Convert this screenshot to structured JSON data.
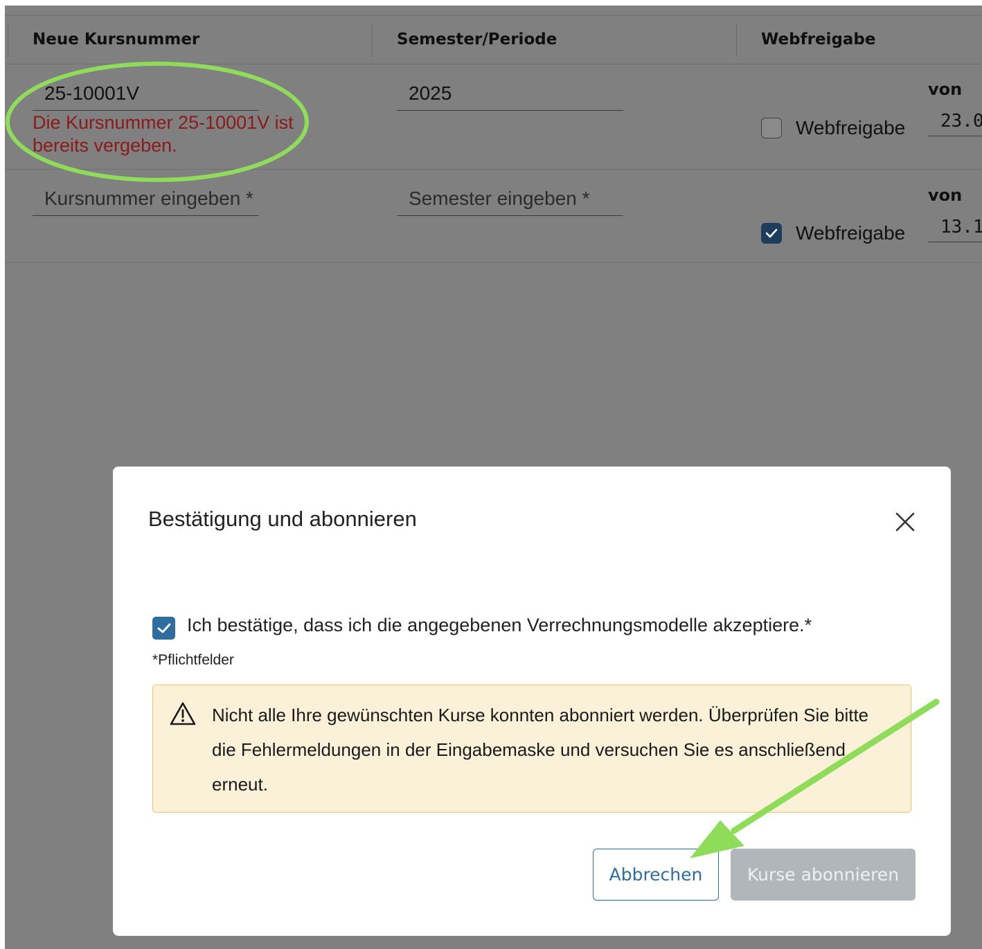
{
  "table": {
    "headers": {
      "course_number": "Neue Kursnummer",
      "semester": "Semester/Periode",
      "web_release": "Webfreigabe"
    },
    "rows": [
      {
        "course_number": "25-10001V",
        "error": "Die Kursnummer 25-10001V ist bereits vergeben.",
        "semester": "2025",
        "web_release_label": "Webfreigabe",
        "web_release_checked": false,
        "von_label": "von",
        "von_value": "23.0"
      },
      {
        "course_number_placeholder": "Kursnummer eingeben *",
        "semester_placeholder": "Semester eingeben *",
        "web_release_label": "Webfreigabe",
        "web_release_checked": true,
        "von_label": "von",
        "von_value": "13.1"
      }
    ]
  },
  "modal": {
    "title": "Bestätigung und abonnieren",
    "close_icon": "close-icon",
    "confirm_label": "Ich bestätige, dass ich die angegebenen Verrechnungsmodelle akzeptiere.*",
    "confirm_checked": true,
    "required_note": "*Pflichtfelder",
    "warning_icon": "warning-triangle-icon",
    "warning_text": "Nicht alle Ihre gewünschten Kurse konnten abonniert werden. Überprüfen Sie bitte die Fehlermeldungen in der Eingabemaske und versuchen Sie es anschließend erneut.",
    "cancel_label": "Abbrechen",
    "subscribe_label": "Kurse abonnieren"
  },
  "colors": {
    "overlay": "#808080",
    "accent": "#2f6d9e",
    "error": "#8b1a1a",
    "annotation": "#8fdc5a",
    "warning_bg": "#fbf1d8",
    "disabled_button": "#b1b6ba"
  }
}
